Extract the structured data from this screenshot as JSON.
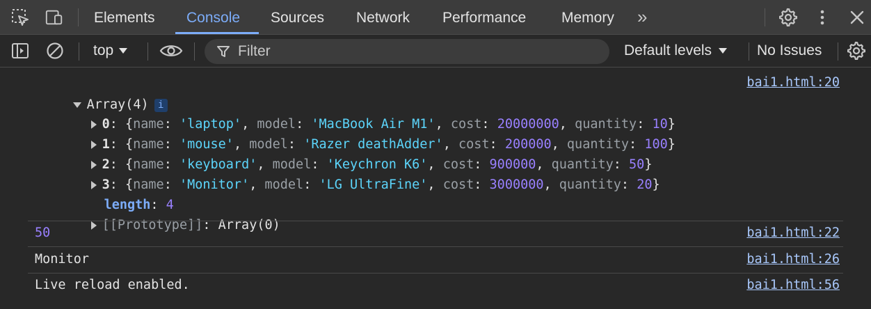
{
  "tabs": {
    "items": [
      "Elements",
      "Console",
      "Sources",
      "Network",
      "Performance",
      "Memory"
    ],
    "active": "Console",
    "more": "»"
  },
  "toolbar": {
    "context": "top",
    "filter_placeholder": "Filter",
    "levels": "Default levels",
    "issues": "No Issues"
  },
  "console": {
    "array_header": "Array(4)",
    "info_badge": "i",
    "items": [
      {
        "index": "0",
        "name": "'laptop'",
        "model": "'MacBook Air M1'",
        "cost": "20000000",
        "quantity": "10"
      },
      {
        "index": "1",
        "name": "'mouse'",
        "model": "'Razer deathAdder'",
        "cost": "200000",
        "quantity": "100"
      },
      {
        "index": "2",
        "name": "'keyboard'",
        "model": "'Keychron K6'",
        "cost": "900000",
        "quantity": "50"
      },
      {
        "index": "3",
        "name": "'Monitor'",
        "model": "'LG UltraFine'",
        "cost": "3000000",
        "quantity": "20"
      }
    ],
    "length_key": "length",
    "length_value": "4",
    "prototype_key": "[[Prototype]]",
    "prototype_value": "Array(0)",
    "messages": [
      {
        "text": "50",
        "source": "bai1.html:22",
        "type": "number"
      },
      {
        "text": "Monitor",
        "source": "bai1.html:26",
        "type": "string"
      },
      {
        "text": "Live reload enabled.",
        "source": "bai1.html:56",
        "type": "string"
      }
    ],
    "array_source": "bai1.html:20"
  },
  "colors": {
    "accent": "#7cacf8",
    "string": "#5cd5fb",
    "number": "#9980ff",
    "background": "#282828"
  }
}
